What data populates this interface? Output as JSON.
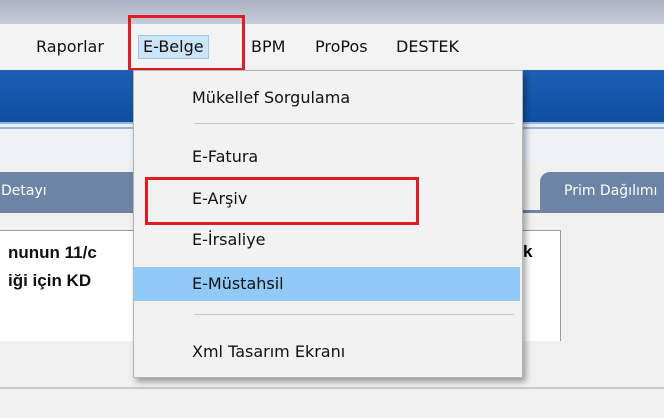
{
  "menubar": {
    "items": [
      {
        "label": "Raporlar"
      },
      {
        "label": "E-Belge"
      },
      {
        "label": "BPM"
      },
      {
        "label": "ProPos"
      },
      {
        "label": "DESTEK"
      }
    ]
  },
  "dropdown": {
    "items": [
      {
        "label": "Mükellef Sorgulama"
      },
      {
        "label": "E-Fatura"
      },
      {
        "label": "E-Arşiv"
      },
      {
        "label": "E-İrsaliye"
      },
      {
        "label": "E-Müstahsil"
      },
      {
        "label": "Xml Tasarım Ekranı"
      }
    ]
  },
  "tabs": {
    "left": "Detayı",
    "right": "Prim Dağılımı"
  },
  "panel": {
    "line1": "nunun 11/c",
    "line2": "iği için KD",
    "right_char": "k"
  },
  "colors": {
    "highlight_box": "#e21a22",
    "selected_item": "#91c9f7",
    "band": "#0f4fa2"
  }
}
